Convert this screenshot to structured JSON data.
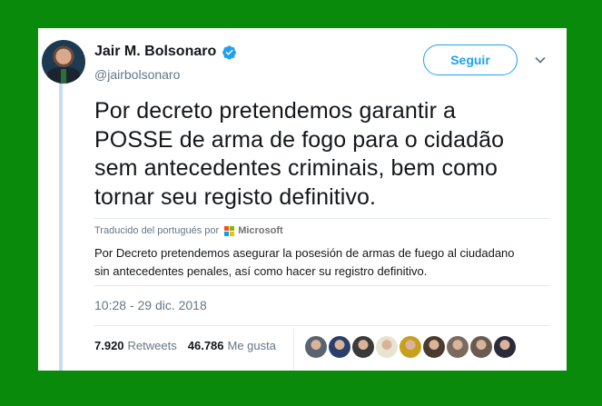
{
  "tweet": {
    "author": {
      "name": "Jair M. Bolsonaro",
      "handle": "@jairbolsonaro",
      "verified": true
    },
    "follow_label": "Seguir",
    "text_lines": [
      "Por decreto pretendemos garantir a",
      "POSSE de arma de fogo para o cidadão",
      "sem antecedentes criminais, bem como",
      "tornar seu registo definitivo."
    ],
    "translation": {
      "credit_label": "Traducido del portugués por",
      "provider": "Microsoft",
      "lines": [
        "Por Decreto pretendemos asegurar la posesión de armas de fuego al ciudadano",
        "sin antecedentes penales, así como hacer su registro definitivo."
      ]
    },
    "timestamp": "10:28 - 29 dic. 2018",
    "stats": {
      "retweets_count": "7.920",
      "retweets_label": "Retweets",
      "likes_count": "46.786",
      "likes_label": "Me gusta"
    },
    "liker_avatar_colors": [
      "#5a6470",
      "#2b3f6b",
      "#3a3a3a",
      "#e8e4d0",
      "#c8a020",
      "#4a3a30",
      "#7a6a60",
      "#6a5a50",
      "#2a2a3a"
    ]
  },
  "colors": {
    "frame": "#0a8a0a",
    "accent": "#1da1f2",
    "text": "#14171a",
    "secondary": "#657786"
  }
}
